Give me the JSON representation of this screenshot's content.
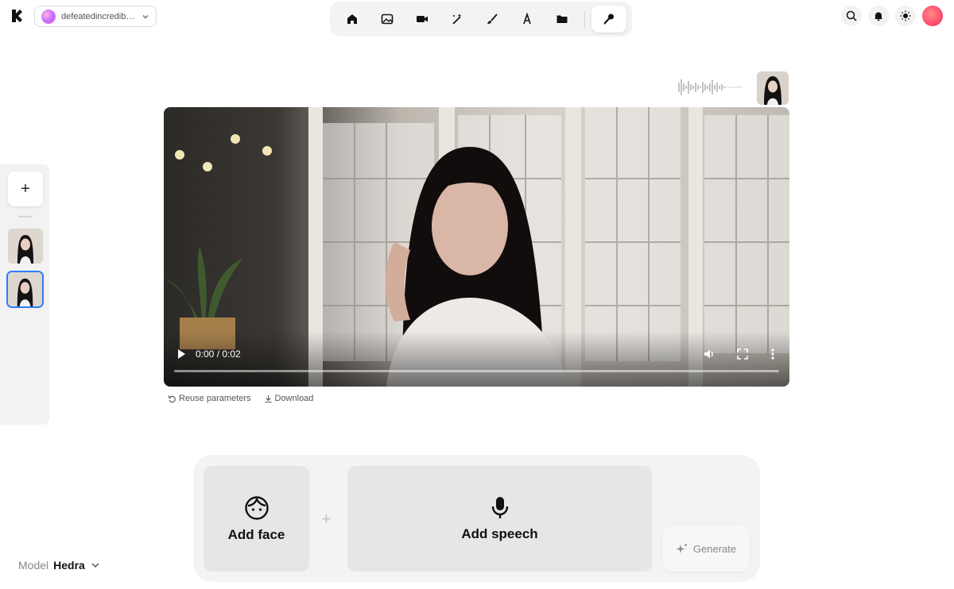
{
  "header": {
    "workspace_name": "defeatedincredib…",
    "tools": [
      {
        "icon": "home-icon"
      },
      {
        "icon": "image-icon"
      },
      {
        "icon": "video-camera-icon"
      },
      {
        "icon": "magic-wand-icon"
      },
      {
        "icon": "brush-icon"
      },
      {
        "icon": "font-icon"
      },
      {
        "icon": "folder-icon"
      },
      {
        "icon": "microphone-icon",
        "active": true
      }
    ],
    "right_icons": [
      "search-icon",
      "bell-icon",
      "sun-icon"
    ]
  },
  "sidebar": {
    "add_label": "+"
  },
  "video": {
    "time": "0:00 / 0:02",
    "progress": 0
  },
  "actions": {
    "reuse_label": "Reuse parameters",
    "download_label": "Download"
  },
  "composer": {
    "face_label": "Add face",
    "speech_label": "Add speech",
    "plus": "+",
    "generate_label": "Generate"
  },
  "model": {
    "label": "Model",
    "value": "Hedra"
  },
  "colors": {
    "accent": "#2f7bf5",
    "panel": "#f3f3f3",
    "card": "#e6e6e6"
  }
}
